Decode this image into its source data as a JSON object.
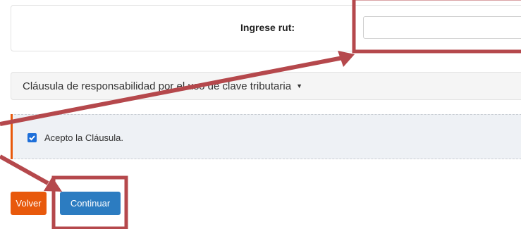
{
  "rut": {
    "label": "Ingrese rut:",
    "input_value": "",
    "input_placeholder": ""
  },
  "clausula": {
    "label": "Cláusula de responsabilidad por el uso de clave tributaria",
    "caret": "▼"
  },
  "accept": {
    "label": "Acepto la Cláusula.",
    "checked": true
  },
  "buttons": {
    "volver": "Volver",
    "continuar": "Continuar"
  },
  "colors": {
    "annotation": "#b5484c",
    "accent_orange": "#e8590c",
    "primary_blue": "#2c7cc1",
    "checkbox_blue": "#1e6fd9"
  }
}
